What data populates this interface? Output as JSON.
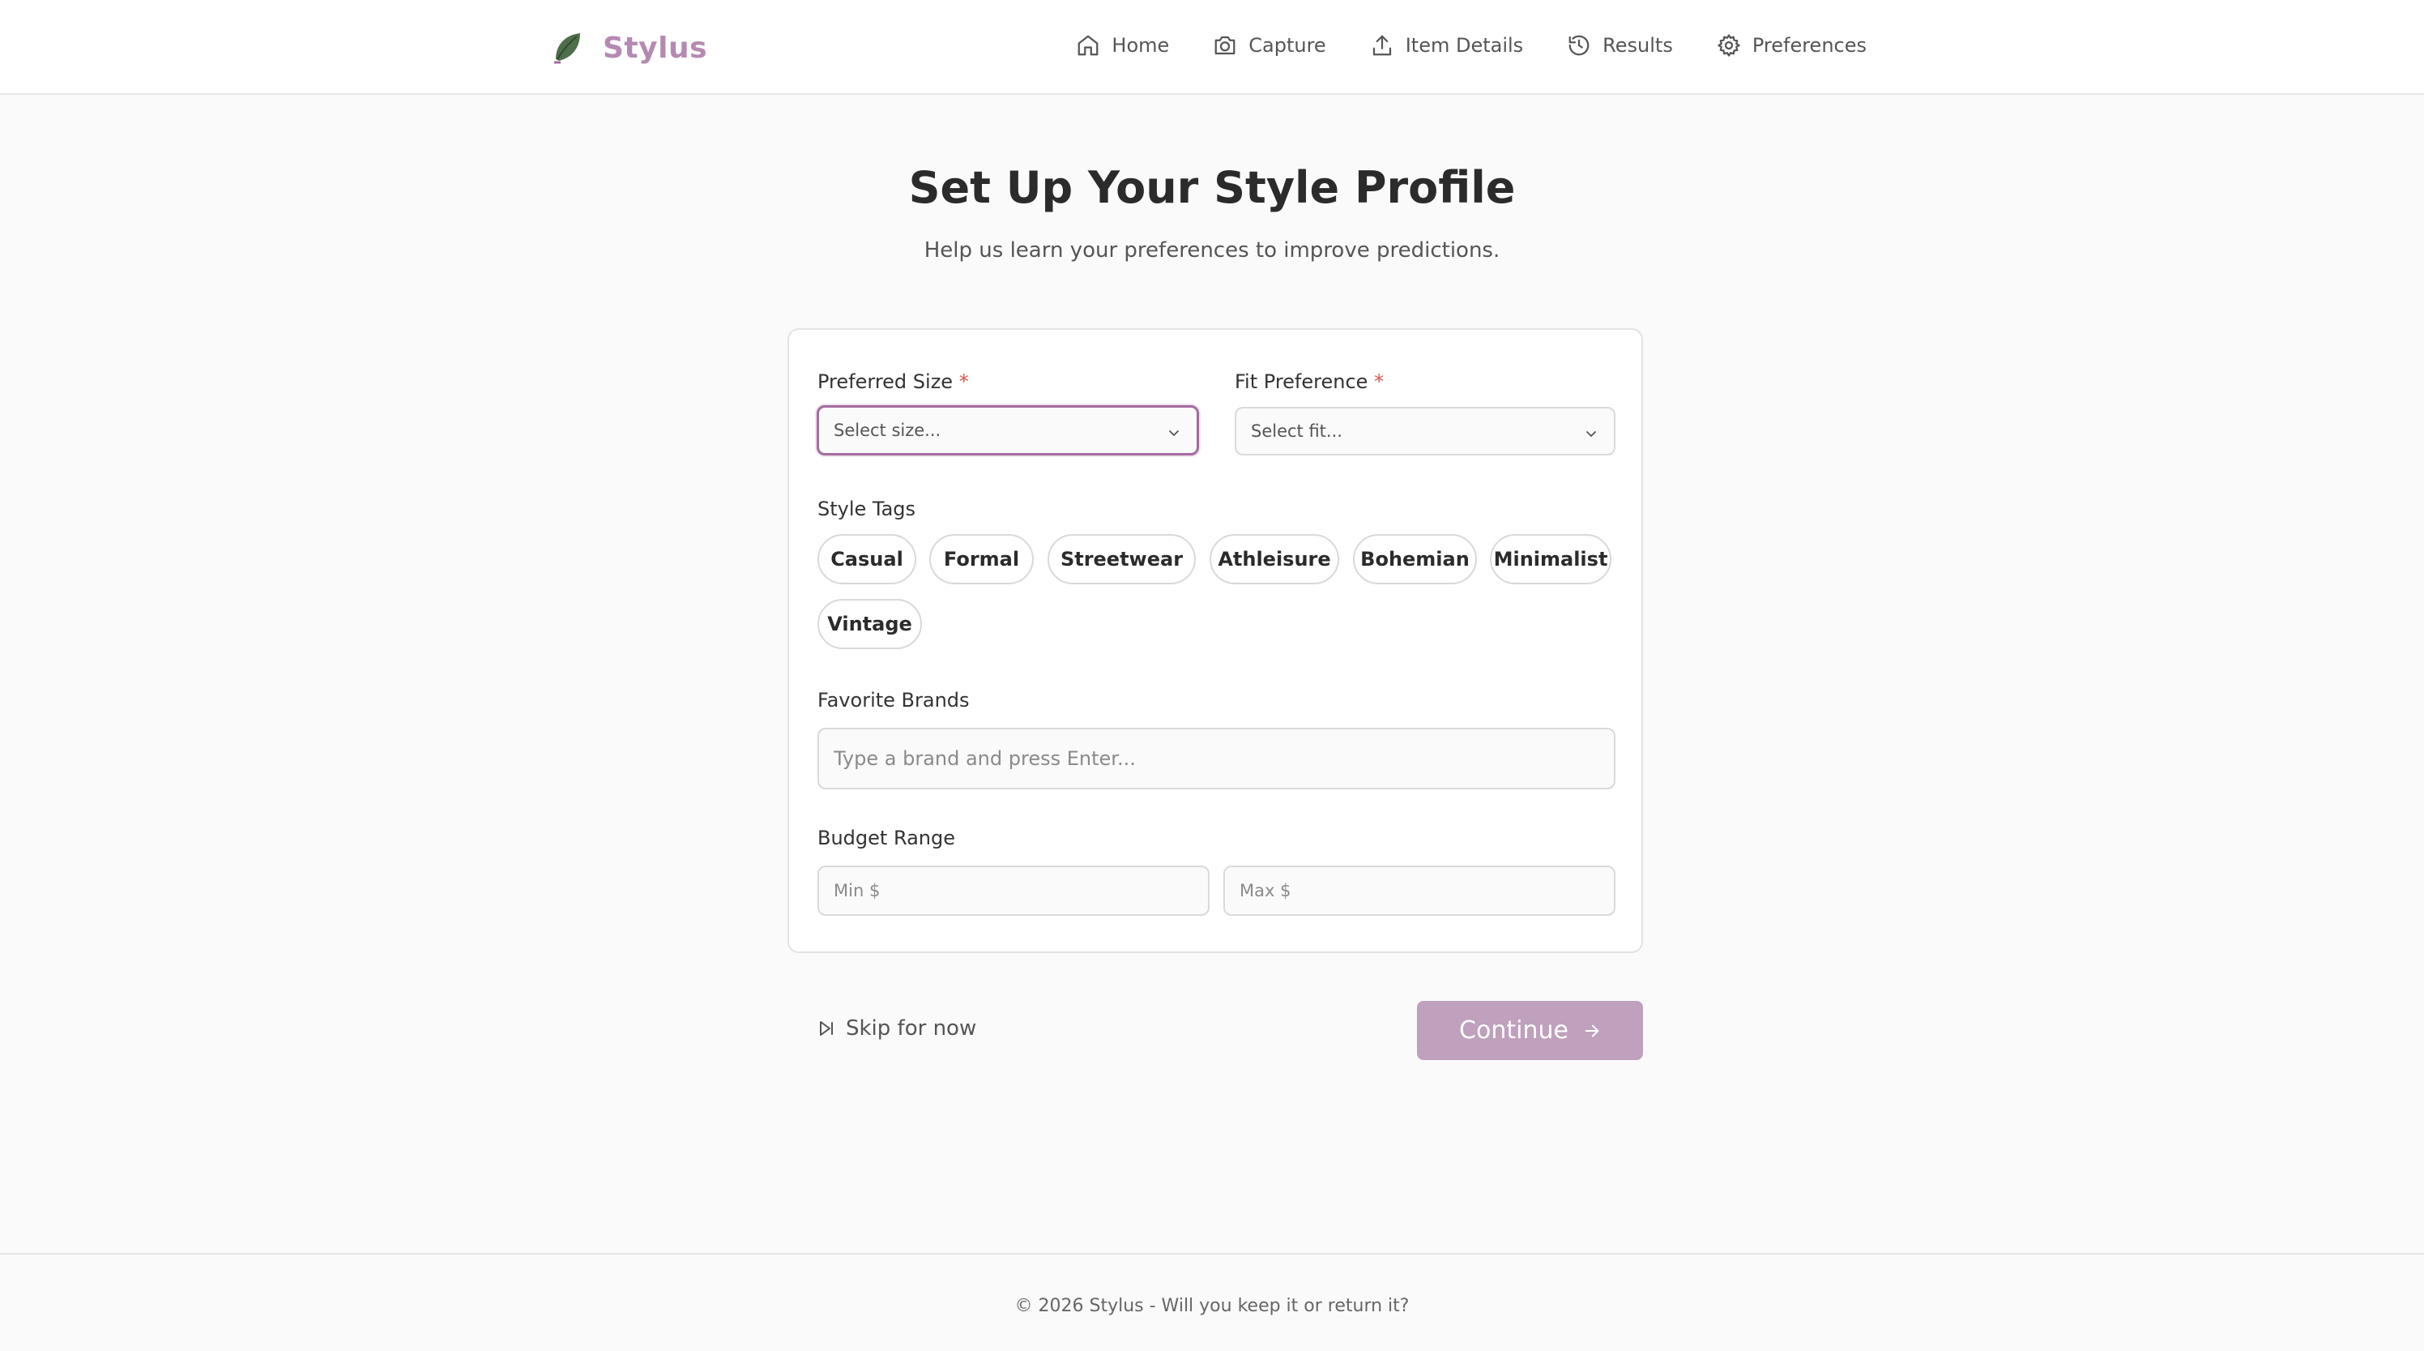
{
  "app": {
    "name": "Stylus"
  },
  "nav": {
    "items": [
      {
        "label": "Home",
        "icon": "home-icon"
      },
      {
        "label": "Capture",
        "icon": "camera-icon"
      },
      {
        "label": "Item Details",
        "icon": "upload-icon"
      },
      {
        "label": "Results",
        "icon": "history-icon"
      },
      {
        "label": "Preferences",
        "icon": "gear-icon"
      }
    ]
  },
  "page": {
    "title": "Set Up Your Style Profile",
    "subtitle": "Help us learn your preferences to improve predictions."
  },
  "form": {
    "size": {
      "label": "Preferred Size",
      "required_mark": "*",
      "placeholder": "Select size...",
      "value": ""
    },
    "fit": {
      "label": "Fit Preference",
      "required_mark": "*",
      "placeholder": "Select fit...",
      "value": ""
    },
    "style_tags": {
      "label": "Style Tags",
      "tags": [
        "Casual",
        "Formal",
        "Streetwear",
        "Athleisure",
        "Bohemian",
        "Minimalist",
        "Vintage"
      ]
    },
    "brands": {
      "label": "Favorite Brands",
      "placeholder": "Type a brand and press Enter...",
      "value": ""
    },
    "budget": {
      "label": "Budget Range",
      "min_placeholder": "Min $",
      "max_placeholder": "Max $",
      "min_value": "",
      "max_value": ""
    }
  },
  "actions": {
    "skip_label": "Skip for now",
    "continue_label": "Continue"
  },
  "footer": {
    "text": "© 2026 Stylus - Will you keep it or return it?"
  },
  "colors": {
    "accent": "#b58ab2",
    "continue_bg": "#bfa0bd",
    "focus_border": "#a56ba0",
    "required": "#d9534f"
  }
}
